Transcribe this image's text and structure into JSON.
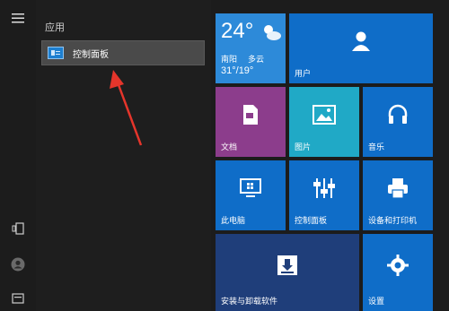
{
  "applist": {
    "section_label": "应用",
    "item_label": "控制面板"
  },
  "weather": {
    "temp": "24°",
    "location": "南阳",
    "condition": "多云",
    "range": "31°/19°"
  },
  "tiles": {
    "user": "用户",
    "documents": "文档",
    "pictures": "图片",
    "music": "音乐",
    "this_pc": "此电脑",
    "control_panel": "控制面板",
    "devices_printers": "设备和打印机",
    "install_uninstall": "安装与卸载软件",
    "settings": "设置"
  },
  "colors": {
    "accent": "#0f6dc8",
    "arrow": "#e5352b"
  }
}
